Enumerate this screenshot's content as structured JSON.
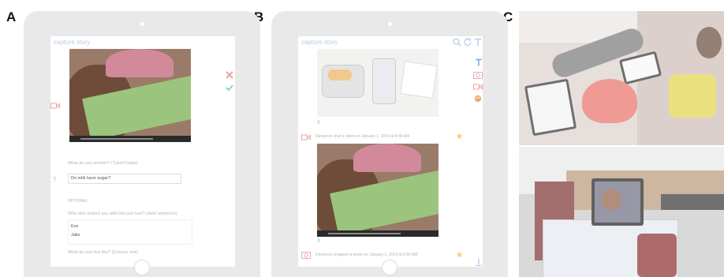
{
  "panels": {
    "a": "A",
    "b": "B",
    "c": "C"
  },
  "panel_a": {
    "app_title": "capture  story",
    "question1": "What do you wonder? (Type/Create)",
    "answer1": "Do milk have sugar?",
    "optional": "OPTIONAL",
    "question2": "Who else helped you with this just now? (Add/ someone)",
    "option1": "Eve",
    "option2": "Jake",
    "question3": "What do you feel like? (Choose one)"
  },
  "panel_b": {
    "app_title": "capture  story",
    "post1": "Demarcio shot a video on January 1, 2014 at 8:58 AM",
    "post2": "Demarcio snapped a photo on January 1, 2014 at 8:56 AM",
    "hashtag": "#"
  },
  "colors": {
    "tablet": "#e9e9e9",
    "accent_blue": "#b8cbe9",
    "accent_red": "#f0a0a0",
    "accent_green": "#8fd6a8",
    "accent_yellow": "#f6d36e",
    "accent_orange": "#f3a86b"
  }
}
